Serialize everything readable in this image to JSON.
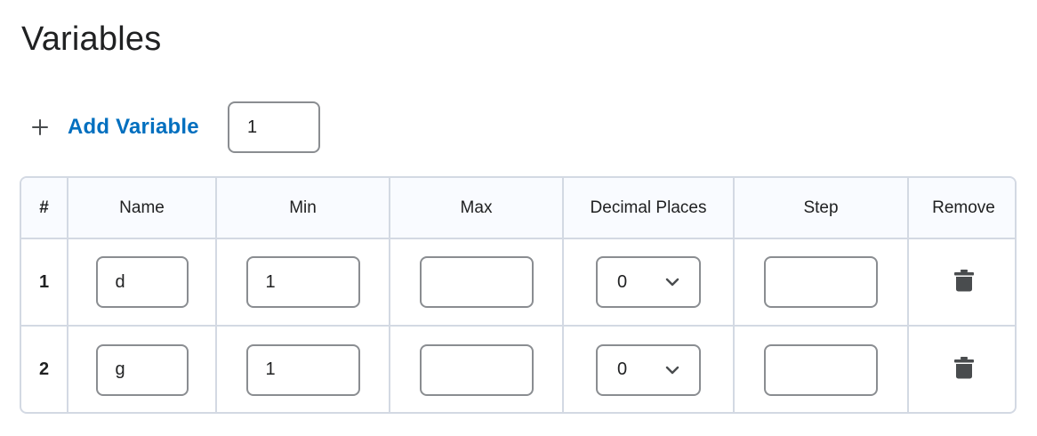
{
  "page": {
    "title": "Variables"
  },
  "add": {
    "label": "Add Variable",
    "count_value": "1"
  },
  "table": {
    "headers": [
      "#",
      "Name",
      "Min",
      "Max",
      "Decimal Places",
      "Step",
      "Remove"
    ],
    "rows": [
      {
        "num": "1",
        "name": "d",
        "min": "1",
        "max": "",
        "decimal": "0",
        "step": ""
      },
      {
        "num": "2",
        "name": "g",
        "min": "1",
        "max": "",
        "decimal": "0",
        "step": ""
      }
    ]
  },
  "colors": {
    "accent": "#006fbf",
    "border": "#d3d9e3",
    "header_bg": "#f9fbff",
    "input_border": "#8a8d91"
  },
  "icons": {
    "add": "plus-icon",
    "remove": "trash-icon",
    "select": "chevron-down-icon"
  }
}
